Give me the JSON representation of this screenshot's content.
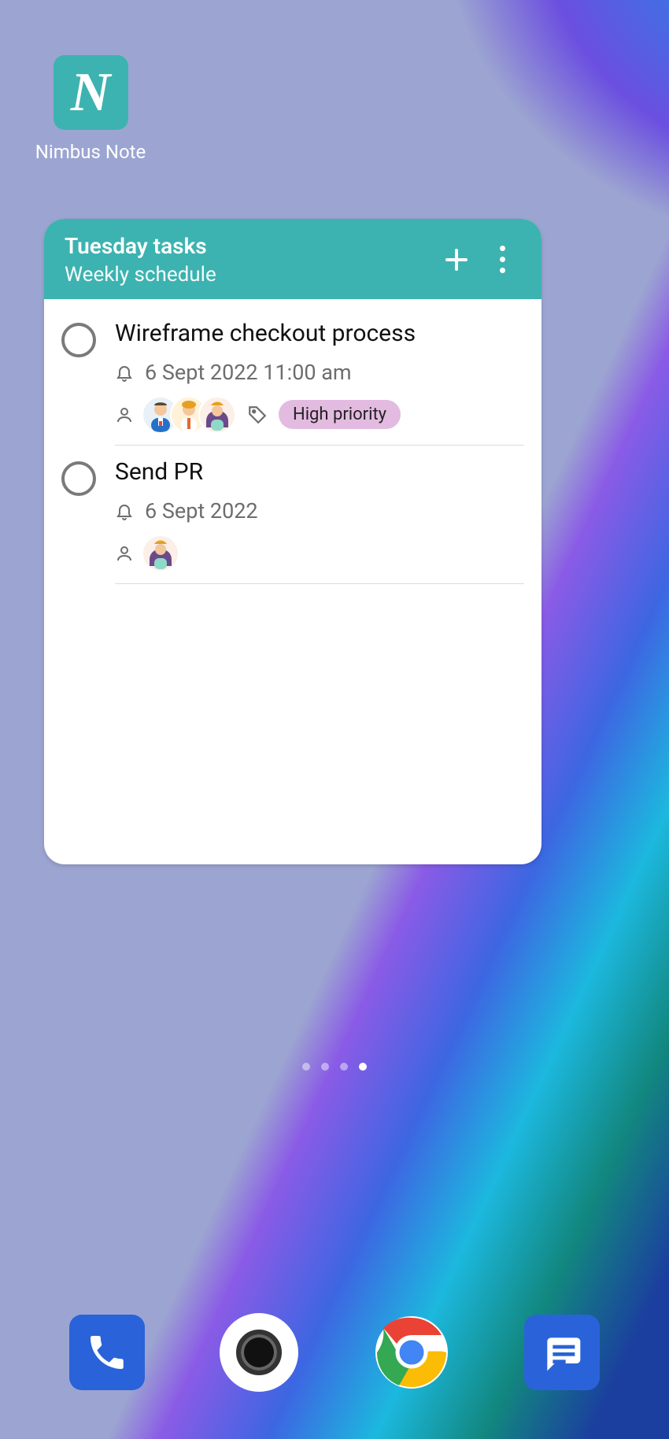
{
  "app": {
    "name": "Nimbus Note",
    "iconLetter": "N"
  },
  "widget": {
    "title": "Tuesday tasks",
    "subtitle": "Weekly schedule"
  },
  "tasks": [
    {
      "title": "Wireframe checkout process",
      "date": "6 Sept 2022 11:00 am",
      "tag": "High priority",
      "avatarCount": 3
    },
    {
      "title": "Send PR",
      "date": "6 Sept 2022",
      "avatarCount": 1
    }
  ],
  "dock": {
    "phone": "Phone",
    "camera": "Camera",
    "chrome": "Chrome",
    "messages": "Messages"
  },
  "pageIndicator": {
    "total": 4,
    "active": 3
  }
}
